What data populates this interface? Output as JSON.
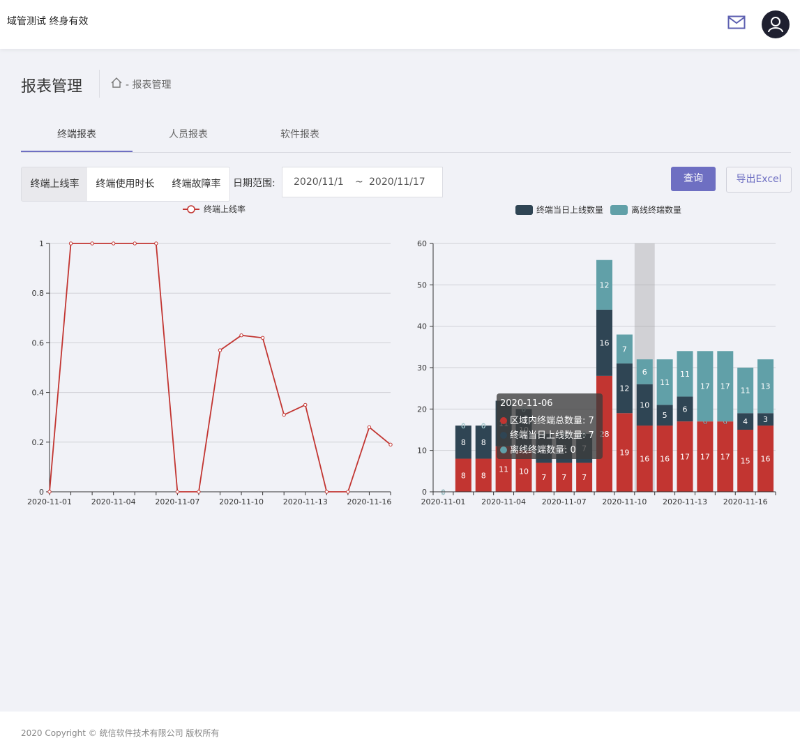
{
  "header": {
    "brand": "域管测试 终身有效"
  },
  "page": {
    "title": "报表管理",
    "breadcrumb": "- 报表管理"
  },
  "tabs": [
    "终端报表",
    "人员报表",
    "软件报表"
  ],
  "segments": [
    "终端上线率",
    "终端使用时长",
    "终端故障率"
  ],
  "filter": {
    "label": "日期范围:",
    "start": "2020/11/1",
    "sep": "~",
    "end": "2020/11/17"
  },
  "buttons": {
    "query": "查询",
    "export": "导出Excel"
  },
  "footer": "2020 Copyright © 统信软件技术有限公司 版权所有",
  "colors": {
    "accent": "#6e6fc2",
    "red": "#c23531",
    "dark": "#2f4554",
    "teal": "#61a0a8"
  },
  "tooltip": {
    "title": "2020-11-06",
    "rows": [
      "区域内终端总数量: 7",
      "终端当日上线数量: 7",
      "离线终端数量: 0"
    ]
  },
  "chart_data": [
    {
      "type": "line",
      "legend": [
        "终端上线率"
      ],
      "x": [
        "2020-11-01",
        "2020-11-02",
        "2020-11-03",
        "2020-11-04",
        "2020-11-05",
        "2020-11-06",
        "2020-11-07",
        "2020-11-08",
        "2020-11-09",
        "2020-11-10",
        "2020-11-11",
        "2020-11-12",
        "2020-11-13",
        "2020-11-14",
        "2020-11-15",
        "2020-11-16",
        "2020-11-17"
      ],
      "xticks": [
        "2020-11-01",
        "2020-11-04",
        "2020-11-07",
        "2020-11-10",
        "2020-11-13",
        "2020-11-16"
      ],
      "series": [
        {
          "name": "终端上线率",
          "values": [
            0,
            1,
            1,
            1,
            1,
            1,
            0,
            0,
            0.57,
            0.63,
            0.62,
            0.31,
            0.35,
            0,
            0,
            0.26,
            0.19
          ]
        }
      ],
      "ylim": [
        0,
        1
      ],
      "yticks": [
        "0",
        "0.2",
        "0.4",
        "0.6",
        "0.8",
        "1"
      ],
      "grid": true
    },
    {
      "type": "bar",
      "stacked": true,
      "legend": [
        "终端当日上线数量",
        "离线终端数量"
      ],
      "x": [
        "2020-11-01",
        "2020-11-02",
        "2020-11-03",
        "2020-11-04",
        "2020-11-05",
        "2020-11-06",
        "2020-11-07",
        "2020-11-08",
        "2020-11-09",
        "2020-11-10",
        "2020-11-11",
        "2020-11-12",
        "2020-11-13",
        "2020-11-14",
        "2020-11-15",
        "2020-11-16",
        "2020-11-17"
      ],
      "xticks": [
        "2020-11-01",
        "2020-11-04",
        "2020-11-07",
        "2020-11-10",
        "2020-11-13",
        "2020-11-16"
      ],
      "series": [
        {
          "name": "区域内终端总数量",
          "values": [
            0,
            8,
            8,
            11,
            10,
            7,
            7,
            7,
            28,
            19,
            16,
            16,
            17,
            17,
            17,
            15,
            16
          ]
        },
        {
          "name": "终端当日上线数量",
          "values": [
            0,
            8,
            8,
            11,
            10,
            7,
            7,
            7,
            16,
            12,
            10,
            5,
            6,
            0,
            0,
            4,
            3
          ]
        },
        {
          "name": "离线终端数量",
          "values": [
            0,
            0,
            0,
            0,
            0,
            0,
            0,
            0,
            12,
            7,
            6,
            11,
            11,
            17,
            17,
            11,
            13
          ]
        }
      ],
      "ylim": [
        0,
        60
      ],
      "yticks": [
        "0",
        "10",
        "20",
        "30",
        "40",
        "50",
        "60"
      ],
      "highlight_index": 10,
      "grid": true
    }
  ]
}
